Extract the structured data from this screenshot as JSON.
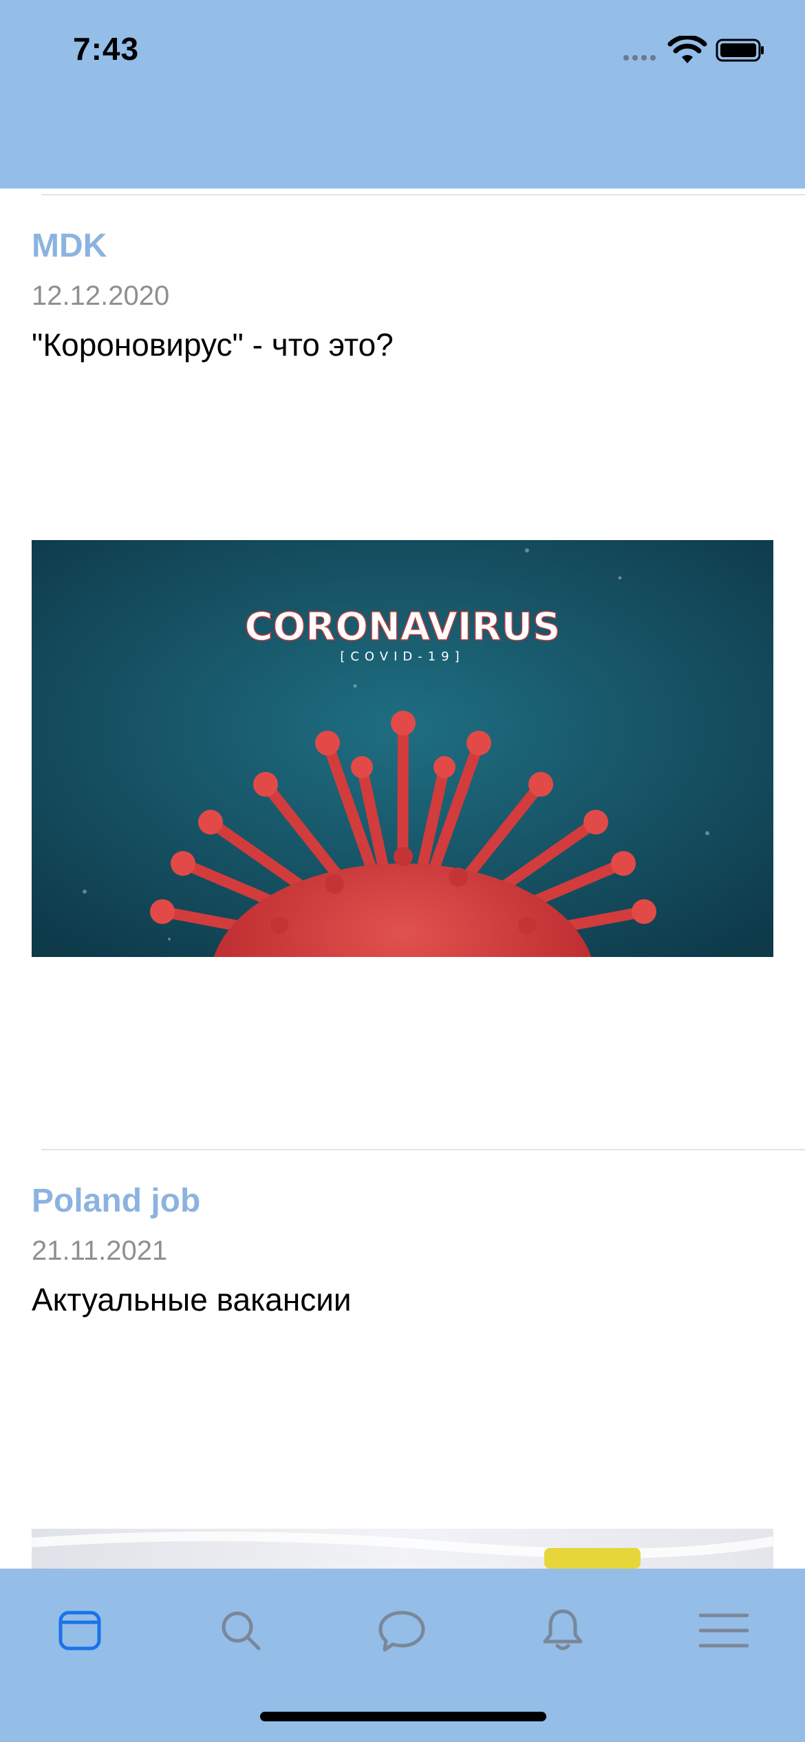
{
  "status_bar": {
    "time": "7:43",
    "icons": [
      "signal-icon",
      "wifi-icon",
      "battery-icon"
    ]
  },
  "feed": {
    "posts": [
      {
        "author": "MDK",
        "date": "12.12.2020",
        "title": "\"Короновирус\" - что это?",
        "image": {
          "headline": "CORONAVIRUS",
          "subheadline": "[COVID-19]"
        }
      },
      {
        "author": "Poland job",
        "date": "21.11.2021",
        "title": "Актуальные вакансии"
      }
    ]
  },
  "tab_bar": {
    "tabs": [
      {
        "icon": "news-feed-icon",
        "active": true
      },
      {
        "icon": "search-icon",
        "active": false
      },
      {
        "icon": "messages-icon",
        "active": false
      },
      {
        "icon": "notifications-icon",
        "active": false
      },
      {
        "icon": "menu-icon",
        "active": false
      }
    ]
  },
  "colors": {
    "bars": "#94bde8",
    "author": "#8cb3df",
    "active_tab": "#1a73e8",
    "inactive_tab": "#7a8798"
  }
}
